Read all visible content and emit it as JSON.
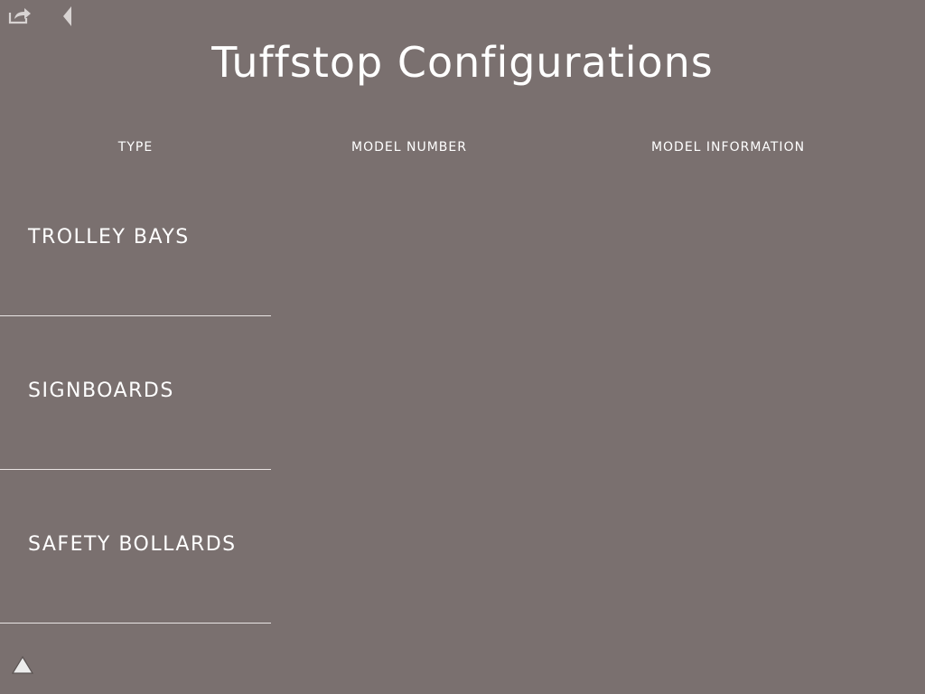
{
  "header": {
    "title": "Tuffstop Configurations",
    "share_icon": "share-icon",
    "back_icon": "back-arrow-icon"
  },
  "columns": {
    "type": "TYPE",
    "model_number": "MODEL NUMBER",
    "model_information": "MODEL INFORMATION"
  },
  "types": [
    {
      "label": "TROLLEY BAYS"
    },
    {
      "label": "SIGNBOARDS"
    },
    {
      "label": "SAFETY BOLLARDS"
    }
  ],
  "footer": {
    "up_icon": "up-triangle-icon"
  },
  "colors": {
    "background": "#7a706f",
    "text": "#ffffff",
    "divider": "#e9e4e3"
  }
}
